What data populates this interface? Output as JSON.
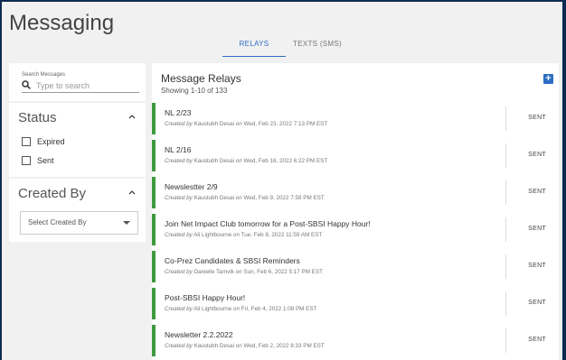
{
  "app": {
    "title": "Messaging"
  },
  "tabs": [
    {
      "label": "RELAYS",
      "active": true
    },
    {
      "label": "TEXTS (SMS)",
      "active": false
    }
  ],
  "search": {
    "label": "Search Messages",
    "placeholder": "Type to search",
    "value": ""
  },
  "status_filter": {
    "title": "Status",
    "options": [
      {
        "label": "Expired",
        "checked": false
      },
      {
        "label": "Sent",
        "checked": false
      }
    ]
  },
  "created_by_filter": {
    "title": "Created By",
    "select_placeholder": "Select Created By"
  },
  "main": {
    "title": "Message Relays",
    "subtitle": "Showing 1-10 of 133",
    "add_icon": "plus-icon",
    "created_by_prefix": "Created by",
    "on_word": "on",
    "relays": [
      {
        "title": "NL 2/23",
        "author": "Kaustubh Desai",
        "date": "Wed, Feb 23, 2022 7:13 PM EST",
        "status": "SENT"
      },
      {
        "title": "NL 2/16",
        "author": "Kaustubh Desai",
        "date": "Wed, Feb 16, 2022 6:22 PM EST",
        "status": "SENT"
      },
      {
        "title": "Newslestter 2/9",
        "author": "Kaustubh Desai",
        "date": "Wed, Feb 9, 2022 7:58 PM EST",
        "status": "SENT"
      },
      {
        "title": "Join Net Impact Club tomorrow for a Post-SBSI Happy Hour!",
        "author": "Ali Lightbourne",
        "date": "Tue, Feb 8, 2022 11:59 AM EST",
        "status": "SENT"
      },
      {
        "title": "Co-Prez Candidates & SBSI Reminders",
        "author": "Danielle Tarnvik",
        "date": "Sun, Feb 6, 2022 5:17 PM EST",
        "status": "SENT"
      },
      {
        "title": "Post-SBSI Happy Hour!",
        "author": "Ali Lightbourne",
        "date": "Fri, Feb 4, 2022 1:08 PM EST",
        "status": "SENT"
      },
      {
        "title": "Newsletter 2.2.2022",
        "author": "Kaustubh Desai",
        "date": "Wed, Feb 2, 2022 8:33 PM EST",
        "status": "SENT"
      }
    ]
  },
  "colors": {
    "accent": "#2b6cc4",
    "sent_bar": "#3f9a3f",
    "frame": "#0e2a52"
  }
}
